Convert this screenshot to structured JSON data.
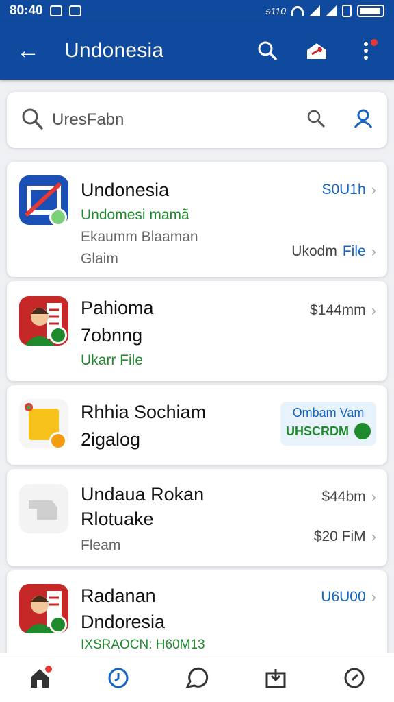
{
  "status": {
    "time": "80:40",
    "carrier": "ᵴ110"
  },
  "app_bar": {
    "back": "←",
    "title": "Undonesia"
  },
  "search": {
    "text": "UresFabn"
  },
  "colors": {
    "primary": "#0f4a9e",
    "green": "#1e8a2c",
    "blue": "#1565c0"
  },
  "icons": [
    "back-arrow-icon",
    "search-icon",
    "share-icon",
    "more-icon",
    "user-icon",
    "home-icon",
    "clock-icon",
    "chat-icon",
    "download-icon",
    "compass-icon"
  ],
  "cards": [
    {
      "name": "Undonesia",
      "subtitle": "Undomesi mamã",
      "desc": "Ekaumm Blaaman",
      "desc2": "Glaim",
      "meta": "S0U1h",
      "link_prefix": "Ukodm",
      "link": "File"
    },
    {
      "name": "Pahioma",
      "subtitle": "7obnng",
      "desc": "Ukarr File",
      "meta": "$144mm"
    },
    {
      "name": "Rhhia Sochiam",
      "subtitle": "2igalog",
      "pill_top": "Ombam Vam",
      "pill_bottom": "UHSCRDM"
    },
    {
      "name": "Undaua Rokan",
      "subtitle": "Rlotuake",
      "desc": "Fleam",
      "meta": "$44bm",
      "meta2": "$20 FiM"
    },
    {
      "name": "Radanan",
      "subtitle": "Dndoresia",
      "desc": "IXSRAOCN: H60M13",
      "meta": "U6U00"
    }
  ]
}
